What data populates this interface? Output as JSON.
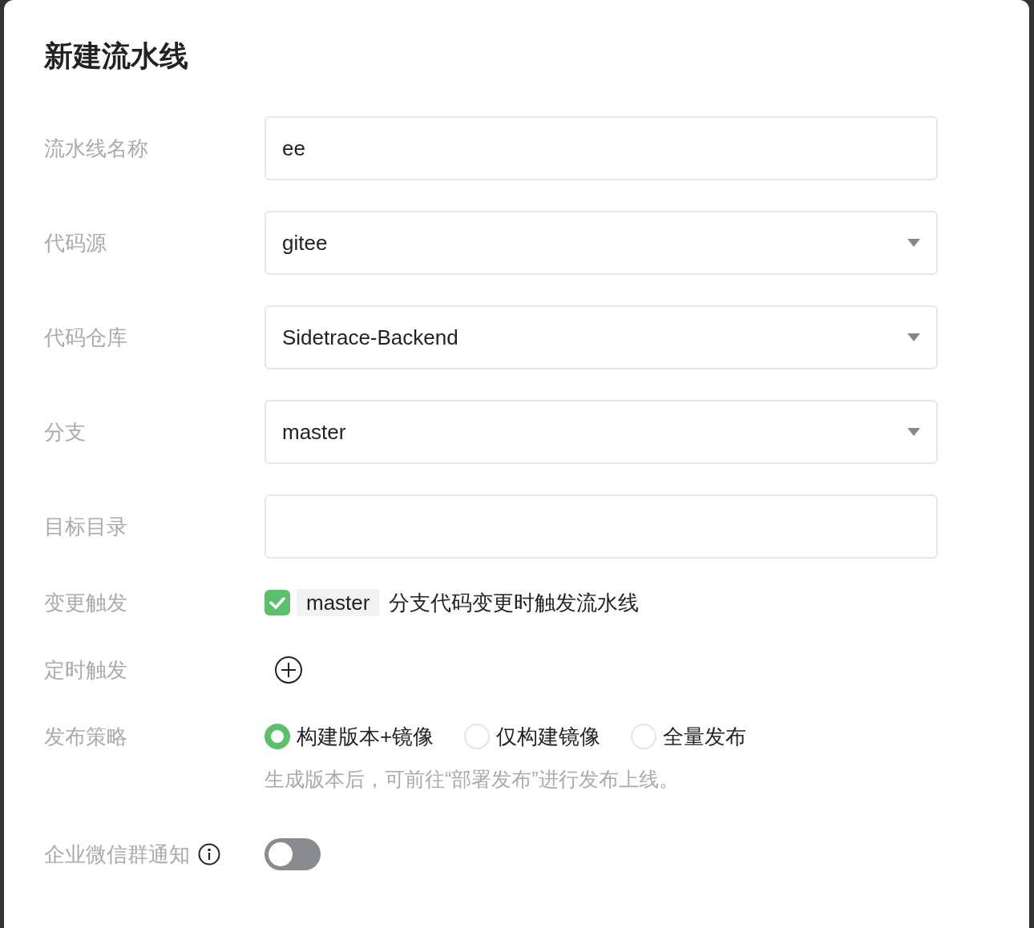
{
  "dialog": {
    "title": "新建流水线"
  },
  "fields": [
    {
      "label": "流水线名称",
      "kind": "text",
      "value": "ee"
    },
    {
      "label": "代码源",
      "kind": "select",
      "value": "gitee"
    },
    {
      "label": "代码仓库",
      "kind": "select",
      "value": "Sidetrace-Backend"
    },
    {
      "label": "分支",
      "kind": "select",
      "value": "master"
    },
    {
      "label": "目标目录",
      "kind": "text"
    }
  ],
  "change_trigger": {
    "label": "变更触发",
    "checked": true,
    "branch": "master",
    "text": "分支代码变更时触发流水线"
  },
  "schedule_trigger": {
    "label": "定时触发"
  },
  "release_strategy": {
    "label": "发布策略",
    "options": [
      {
        "label": "构建版本+镜像",
        "selected": true
      },
      {
        "label": "仅构建镜像",
        "selected": false
      },
      {
        "label": "全量发布",
        "selected": false
      }
    ],
    "hint": "生成版本后，可前往“部署发布”进行发布上线。"
  },
  "wecom_notify": {
    "label": "企业微信群通知",
    "on": false
  }
}
